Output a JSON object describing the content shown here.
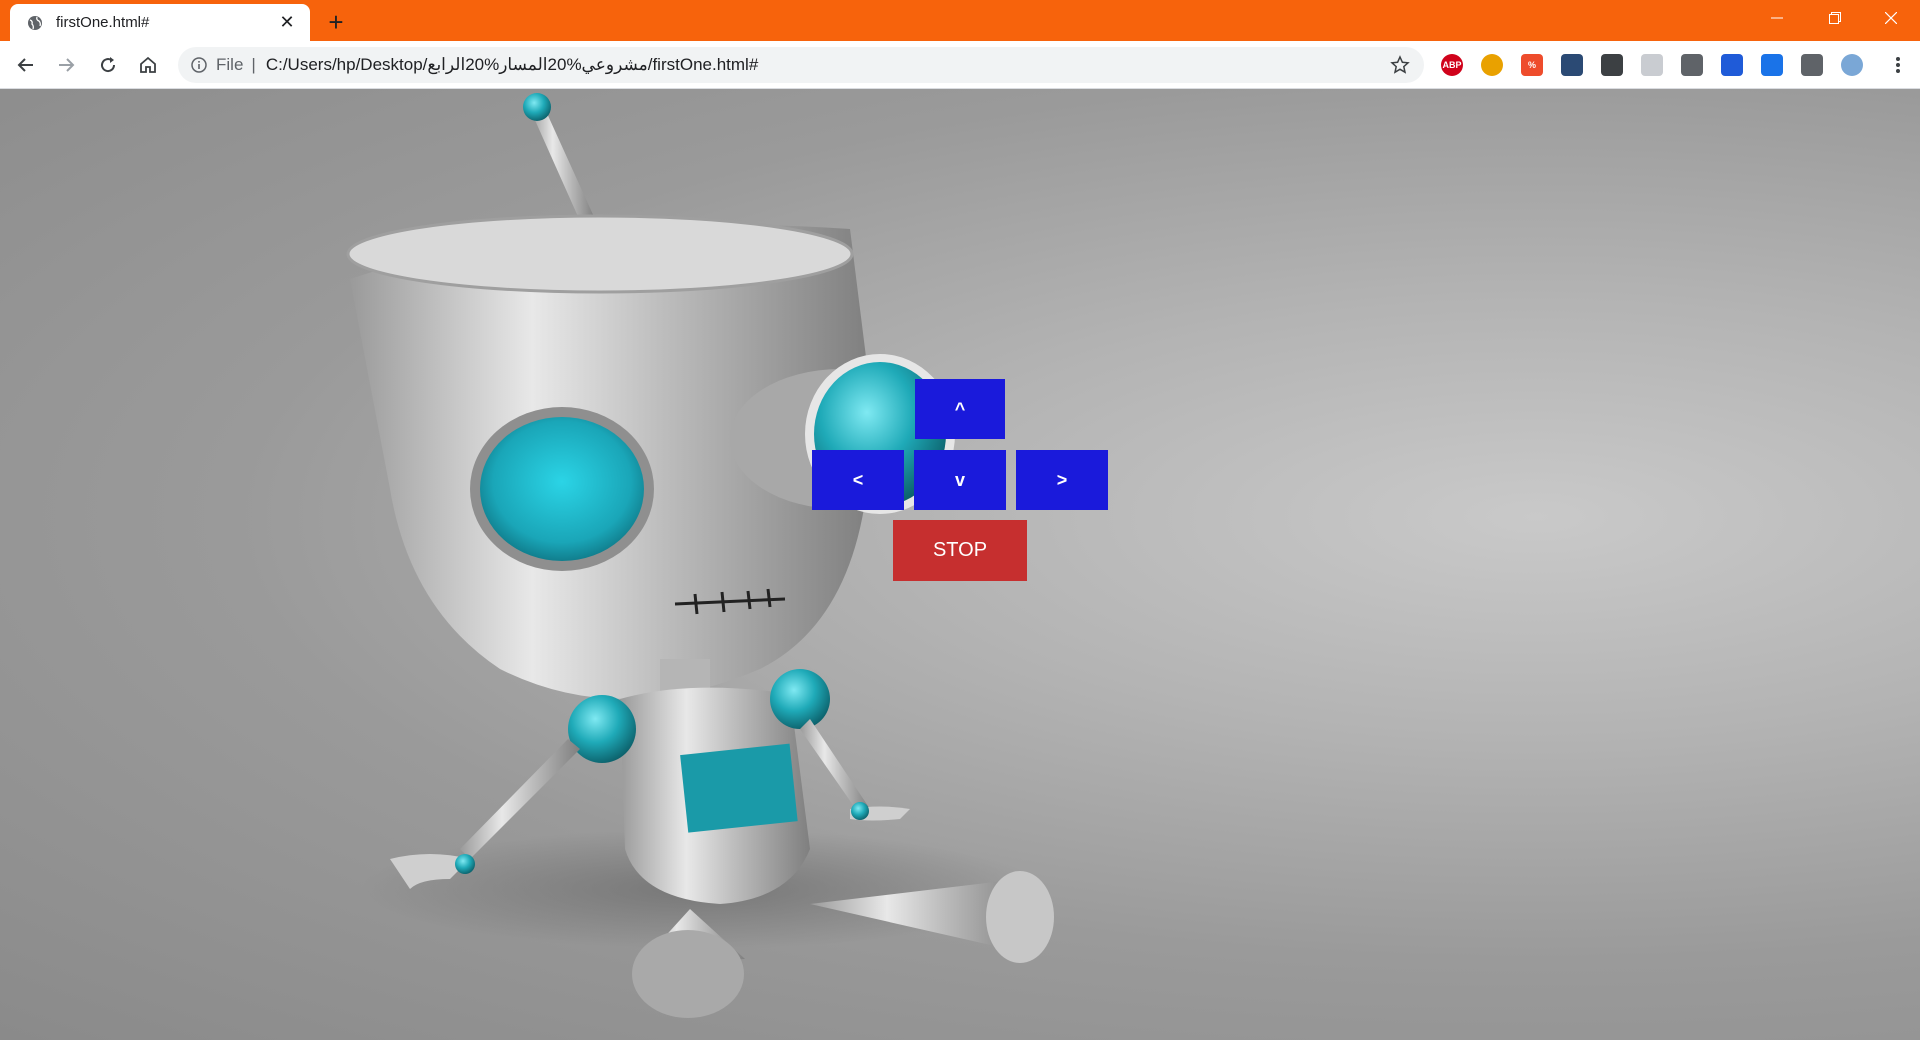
{
  "browser": {
    "chrome_color": "#f7630c",
    "tab": {
      "title": "firstOne.html#",
      "favicon": "globe-icon"
    },
    "new_tab_label": "+",
    "address": {
      "scheme": "File",
      "separator": "|",
      "url": "C:/Users/hp/Desktop/مشروعي%20المسار%20الرابع/firstOne.html#"
    },
    "extensions": [
      {
        "name": "adblock-plus-icon",
        "label": "ABP",
        "color": "#d0021b"
      },
      {
        "name": "color-wheel-icon",
        "label": "",
        "color": "#e9a100"
      },
      {
        "name": "pdf-tool-icon",
        "label": "%",
        "color": "#ee4c2c"
      },
      {
        "name": "shield-ext-icon",
        "label": "",
        "color": "#2b4a74"
      },
      {
        "name": "location-ext-icon",
        "label": "",
        "color": "#3c4043"
      },
      {
        "name": "box-ext-icon",
        "label": "",
        "color": "#c9ccd1"
      },
      {
        "name": "helmet-ext-icon",
        "label": "",
        "color": "#5f6368"
      },
      {
        "name": "window-ext-icon",
        "label": "",
        "color": "#1f5bd8"
      },
      {
        "name": "wave-ext-icon",
        "label": "",
        "color": "#1a73e8"
      },
      {
        "name": "puzzle-icon",
        "label": "",
        "color": "#5f6368"
      },
      {
        "name": "profile-avatar",
        "label": "",
        "color": "#7aa7d6"
      }
    ]
  },
  "controls": {
    "up_label": "^",
    "left_label": "<",
    "down_label": "v",
    "right_label": ">",
    "stop_label": "STOP",
    "button_color": "#1a1adb",
    "stop_color": "#c62f2f"
  }
}
